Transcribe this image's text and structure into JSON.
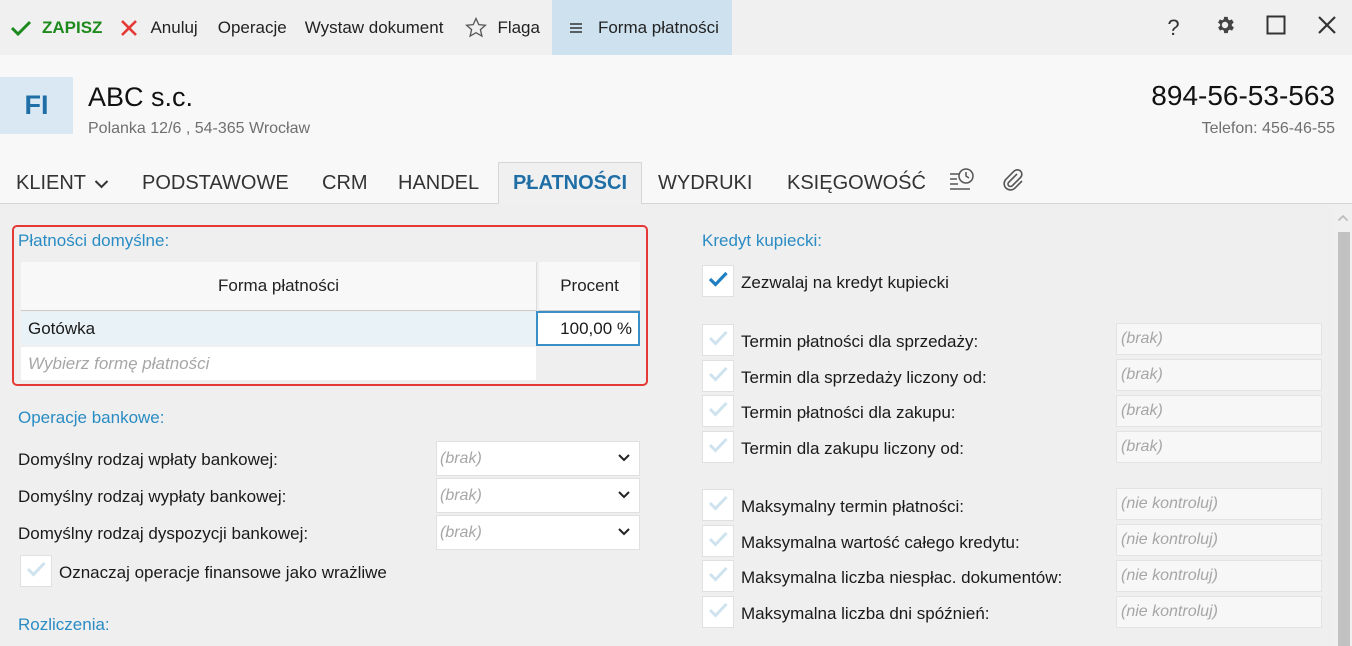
{
  "toolbar": {
    "save_label": "ZAPISZ",
    "cancel_label": "Anuluj",
    "operations_label": "Operacje",
    "issue_document_label": "Wystaw dokument",
    "flag_label": "Flaga",
    "payment_form_label": "Forma płatności",
    "help_label": "?"
  },
  "header": {
    "avatar_initials": "FI",
    "company_name": "ABC s.c.",
    "address": "Polanka  12/6 , 54-365 Wrocław",
    "tax_id": "894-56-53-563",
    "phone": "Telefon: 456-46-55"
  },
  "tabs": [
    {
      "label": "KLIENT"
    },
    {
      "label": "PODSTAWOWE"
    },
    {
      "label": "CRM"
    },
    {
      "label": "HANDEL"
    },
    {
      "label": "PŁATNOŚCI"
    },
    {
      "label": "WYDRUKI"
    },
    {
      "label": "KSIĘGOWOŚĆ"
    }
  ],
  "default_payments": {
    "title": "Płatności domyślne:",
    "columns": [
      "Forma płatności",
      "Procent"
    ],
    "rows": [
      {
        "form": "Gotówka",
        "percent": "100,00 %"
      }
    ],
    "new_row_placeholder": "Wybierz formę płatności"
  },
  "bank_operations": {
    "title": "Operacje bankowe:",
    "fields": [
      {
        "label": "Domyślny rodzaj wpłaty bankowej:",
        "value": "(brak)"
      },
      {
        "label": "Domyślny rodzaj wypłaty bankowej:",
        "value": "(brak)"
      },
      {
        "label": "Domyślny rodzaj dyspozycji bankowej:",
        "value": "(brak)"
      }
    ],
    "sensitive_checkbox_label": "Oznaczaj operacje finansowe jako wrażliwe"
  },
  "settlements": {
    "title": "Rozliczenia:"
  },
  "trade_credit": {
    "title": "Kredyt kupiecki:",
    "allow_label": "Zezwalaj na kredyt kupiecki",
    "allow_checked": true,
    "terms": [
      {
        "label": "Termin płatności dla sprzedaży:",
        "value": "(brak)"
      },
      {
        "label": "Termin dla sprzedaży liczony od:",
        "value": "(brak)"
      },
      {
        "label": "Termin płatności dla zakupu:",
        "value": "(brak)"
      },
      {
        "label": "Termin dla zakupu liczony od:",
        "value": "(brak)"
      }
    ],
    "limits": [
      {
        "label": "Maksymalny termin płatności:",
        "value": "(nie kontroluj)"
      },
      {
        "label": "Maksymalna wartość całego kredytu:",
        "value": "(nie kontroluj)"
      },
      {
        "label": "Maksymalna liczba niespłac. dokumentów:",
        "value": "(nie kontroluj)"
      },
      {
        "label": "Maksymalna liczba dni spóźnień:",
        "value": "(nie kontroluj)"
      }
    ]
  },
  "colors": {
    "accent": "#2a8cc4",
    "active_tab": "#1f6fa6",
    "save_green": "#1e8a1e",
    "cancel_red": "#e53935",
    "highlight_frame": "#e53935",
    "payment_button_bg": "#cde1ef"
  }
}
